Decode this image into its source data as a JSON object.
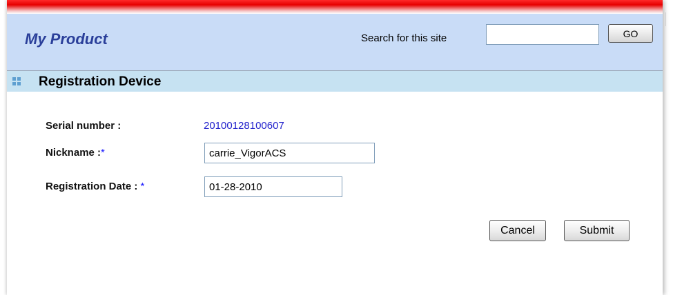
{
  "header": {
    "product_title": "My Product",
    "search_label": "Search for this site",
    "search_value": "",
    "go_label": "GO"
  },
  "section": {
    "title": "Registration Device",
    "icon": "grid-icon"
  },
  "form": {
    "serial_label": "Serial number :",
    "serial_value": "20100128100607",
    "nickname_label": "Nickname :",
    "nickname_required": "*",
    "nickname_value": "carrie_VigorACS",
    "date_label": "Registration Date : ",
    "date_required": "*",
    "date_value": "01-28-2010"
  },
  "actions": {
    "cancel_label": "Cancel",
    "submit_label": "Submit"
  },
  "colors": {
    "top_stripe": "#e60000",
    "header_bg": "#c9dcf7",
    "title_color": "#2a3f9a",
    "section_bg": "#c6e2f2",
    "link_value_color": "#2222cc"
  }
}
